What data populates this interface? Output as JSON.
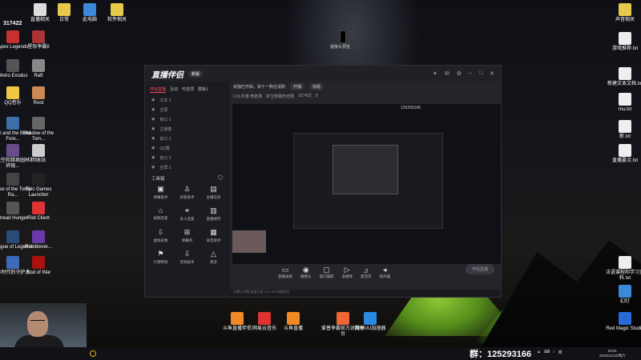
{
  "desktop": {
    "top_number": "317422",
    "camera_caption": "摄像头预览",
    "icons_left": [
      {
        "label": "Apex Legends",
        "color": "#c53030"
      },
      {
        "label": "Metro Exodus",
        "color": "#555"
      },
      {
        "label": "QQ音乐",
        "color": "#f2c744"
      },
      {
        "label": "Ori and the Blind Fore...",
        "color": "#3d6fa8"
      },
      {
        "label": "《天空和猎君园林》终极...",
        "color": "#6b4c8a"
      },
      {
        "label": "Rise of the Tomb Ra...",
        "color": "#444"
      },
      {
        "label": "Dread Hunger",
        "color": "#555"
      },
      {
        "label": "League of Legends",
        "color": "#2a4a7a"
      },
      {
        "label": "三体时代的守护大...",
        "color": "#3a6ab8"
      }
    ],
    "icons_left2": [
      {
        "label": "星际争霸II",
        "color": "#a33"
      },
      {
        "label": "Raft",
        "color": "#888"
      },
      {
        "label": "Root",
        "color": "#c85"
      },
      {
        "label": "Shadow of the Tom...",
        "color": "#666"
      },
      {
        "label": "回收站",
        "color": "#ccc"
      },
      {
        "label": "Epic Games Launcher",
        "color": "#222"
      },
      {
        "label": "Riot Client",
        "color": "#d33"
      },
      {
        "label": "Rumblever...",
        "color": "#6a3aa8"
      },
      {
        "label": "God of War",
        "color": "#a11"
      }
    ],
    "icons_top": [
      {
        "label": "直播相关",
        "color": "#ddd"
      },
      {
        "label": "日常",
        "color": "#e6c94b"
      },
      {
        "label": "此电脑",
        "color": "#3a8ad8"
      },
      {
        "label": "软件相关",
        "color": "#e6c94b"
      }
    ],
    "icons_right": [
      {
        "label": "声音相关",
        "color": "#e6c94b"
      },
      {
        "label": "游戏推荐.txt",
        "color": "#eee"
      },
      {
        "label": "新建文本文档.txt",
        "color": "#eee"
      },
      {
        "label": "mu.txt",
        "color": "#eee"
      },
      {
        "label": "新.txt",
        "color": "#eee"
      },
      {
        "label": "直播要点.txt",
        "color": "#eee"
      },
      {
        "label": "法语课程和学习资料.txt",
        "color": "#eee"
      },
      {
        "label": "幻灯",
        "color": "#3a8ad8"
      },
      {
        "label": "Red Magic Studio",
        "color": "#2a6ad8"
      }
    ],
    "icons_bottom": [
      {
        "label": "斗鱼直播伴侣",
        "color": "#f08a24"
      },
      {
        "label": "网易云音乐",
        "color": "#d33"
      },
      {
        "label": "斗鱼直播",
        "color": "#f08a24"
      },
      {
        "label": "爱普争霸官方对战平台",
        "color": "#e63"
      },
      {
        "label": "网易UU加速器",
        "color": "#2a8ae0"
      }
    ]
  },
  "app": {
    "logo": "直播伴侣",
    "badge": "新版",
    "tabs": [
      "开始直播",
      "互动",
      "可选项",
      "模板1"
    ],
    "sources": [
      "文本 1",
      "全屏",
      "窗口 1",
      "主摄像",
      "窗口 2",
      "QQ群",
      "窗口 3",
      "全屏 1"
    ],
    "tools_header": "工具箱",
    "tools": [
      {
        "label": "弹幕助手",
        "icon": "▣"
      },
      {
        "label": "房管助手",
        "icon": "♙"
      },
      {
        "label": "主播任务",
        "icon": "▤"
      },
      {
        "label": "视频连麦",
        "icon": "⌂"
      },
      {
        "label": "多人连麦",
        "icon": "⚭"
      },
      {
        "label": "直播保存",
        "icon": "▥"
      },
      {
        "label": "虚拟形象",
        "icon": "⇩"
      },
      {
        "label": "弹幕鸡",
        "icon": "⊞"
      },
      {
        "label": "语音助手",
        "icon": "▦"
      },
      {
        "label": "礼物特效",
        "icon": "⚑"
      },
      {
        "label": "音效助手",
        "icon": "⇩"
      },
      {
        "label": "更多",
        "icon": "△"
      }
    ],
    "top_bar": {
      "notice": "双独已开启，双十一购往请购",
      "pill": "开播",
      "field": "标题"
    },
    "sub_bar": {
      "game": "LOL手游·竞技场",
      "room": "护卫你我仍无限",
      "room_id": "317422",
      "fans": "0"
    },
    "bottom_buttons": [
      {
        "label": "直播录屏",
        "icon": "▭"
      },
      {
        "label": "摄像头",
        "icon": "◉"
      },
      {
        "label": "窗口捕获",
        "icon": "▢"
      },
      {
        "label": "多媒体",
        "icon": "▷"
      },
      {
        "label": "麦克风",
        "icon": "♫"
      },
      {
        "label": "扬声器",
        "icon": "◂"
      }
    ],
    "go_live": "开始直播",
    "preview_label": "125293166",
    "status_text": "主播已开播  连接正常  CPU 3%  网络良好"
  },
  "taskbar": {
    "group": "群：125293166",
    "time": "23:01",
    "date": "2022/11/12/周六",
    "tray": [
      "▲",
      "⌨",
      "♪",
      "英"
    ]
  }
}
